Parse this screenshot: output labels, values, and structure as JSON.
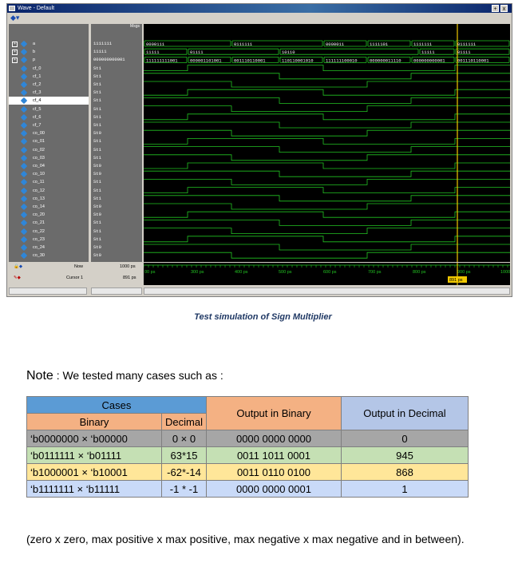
{
  "window": {
    "title": "Wave - Default",
    "min_icon": "+",
    "close_icon": "x"
  },
  "panels": {
    "values_header": "Msgs"
  },
  "signals": [
    {
      "name": "a",
      "value": "1111111",
      "bus": true
    },
    {
      "name": "b",
      "value": "11111",
      "bus": true
    },
    {
      "name": "p",
      "value": "000000000001",
      "bus": true
    },
    {
      "name": "cf_0",
      "value": "St1"
    },
    {
      "name": "cf_1",
      "value": "St1"
    },
    {
      "name": "cf_2",
      "value": "St1"
    },
    {
      "name": "cf_3",
      "value": "St1"
    },
    {
      "name": "cf_4",
      "value": "St1"
    },
    {
      "name": "cf_5",
      "value": "St1"
    },
    {
      "name": "cf_6",
      "value": "St1"
    },
    {
      "name": "cf_7",
      "value": "St1"
    },
    {
      "name": "co_00",
      "value": "St0"
    },
    {
      "name": "co_01",
      "value": "St1"
    },
    {
      "name": "co_02",
      "value": "St1"
    },
    {
      "name": "co_03",
      "value": "St1"
    },
    {
      "name": "co_04",
      "value": "St0"
    },
    {
      "name": "co_10",
      "value": "St0"
    },
    {
      "name": "co_11",
      "value": "St1"
    },
    {
      "name": "co_12",
      "value": "St1"
    },
    {
      "name": "co_13",
      "value": "St1"
    },
    {
      "name": "co_14",
      "value": "St0"
    },
    {
      "name": "co_20",
      "value": "St0"
    },
    {
      "name": "co_21",
      "value": "St1"
    },
    {
      "name": "co_22",
      "value": "St1"
    },
    {
      "name": "co_23",
      "value": "St1"
    },
    {
      "name": "co_24",
      "value": "St0"
    },
    {
      "name": "co_30",
      "value": "St0"
    }
  ],
  "bus_labels": {
    "a": [
      "0000111",
      "0111111",
      "0000011",
      "1111101",
      "1111111",
      "0111111"
    ],
    "b": [
      "11111",
      "01111",
      "10110",
      "11111",
      "01111"
    ],
    "p": [
      "111111111001",
      "000001101001",
      "001110110001",
      "110110001010",
      "111111100010",
      "000000011110",
      "000000000001",
      "001110110001"
    ]
  },
  "status": {
    "now_label": "Now",
    "now_value": "1000 ps",
    "cursor_label": "Cursor 1",
    "cursor_value": "891 ps",
    "cursor_badge": "891 ps"
  },
  "time_axis": [
    "00 ps",
    "300 ps",
    "400 ps",
    "500 ps",
    "600 ps",
    "700 ps",
    "800 ps",
    "900 ps",
    "1000"
  ],
  "caption": "Test simulation of Sign Multiplier",
  "note": {
    "lead": "Note",
    "rest": ":  We tested many cases such as :"
  },
  "table": {
    "header_cases": "Cases",
    "header_binary": "Binary",
    "header_decimal": "Decimal",
    "header_out_bin": "Output in Binary",
    "header_out_dec": "Output in Decimal",
    "rows": [
      {
        "binary": "‘b0000000  ×  ‘b00000",
        "decimal": "0 × 0",
        "out_bin": "0000 0000 0000",
        "out_dec": "0"
      },
      {
        "binary": "‘b0111111  ×  ‘b01111",
        "decimal": "63*15",
        "out_bin": "0011 1011 0001",
        "out_dec": "945"
      },
      {
        "binary": "‘b1000001  ×  ‘b10001",
        "decimal": "-62*-14",
        "out_bin": "0011 0110 0100",
        "out_dec": "868"
      },
      {
        "binary": "‘b1111111  ×  ‘b11111",
        "decimal": "-1 * -1",
        "out_bin": "0000 0000 0001",
        "out_dec": "1"
      }
    ]
  },
  "footer": "(zero x zero, max positive x max positive, max negative x max negative and in between)."
}
